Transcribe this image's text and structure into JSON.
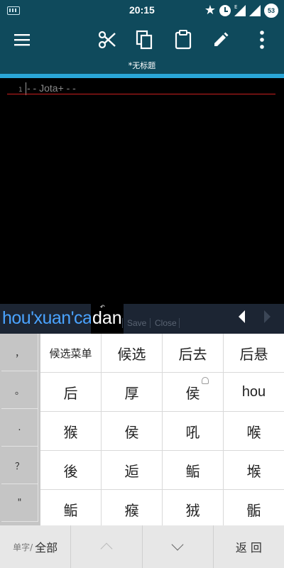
{
  "status_bar": {
    "time": "20:15",
    "network_label": "E",
    "battery": "53",
    "icons": [
      "keyboard-icon",
      "star-icon",
      "alarm-icon",
      "signal-icon",
      "battery-icon"
    ]
  },
  "toolbar": {
    "icons": [
      "menu-icon",
      "cut-icon",
      "copy-icon",
      "paste-icon",
      "edit-icon",
      "more-icon"
    ],
    "doc_title": "*无标题"
  },
  "editor": {
    "line_number": "1",
    "line_text": "- - Jota+ - -"
  },
  "ime": {
    "composing_prefix": "hou'xuan'cai'",
    "composing_active": "dan",
    "save_label": "Save",
    "close_label": "Close",
    "punctuation": [
      "，",
      "。",
      ".",
      "？",
      "\""
    ],
    "candidates": [
      [
        "候选菜单",
        "候选",
        "后去",
        "后悬"
      ],
      [
        "后",
        "厚",
        "侯",
        "hou"
      ],
      [
        "猴",
        "侯",
        "吼",
        "喉"
      ],
      [
        "後",
        "逅",
        "鲘",
        "堠"
      ],
      [
        "鲘",
        "瘊",
        "狨",
        "骺"
      ]
    ],
    "bottom": {
      "mode_small": "单字/",
      "mode_label": "全部",
      "back_label": "返 回"
    }
  },
  "colors": {
    "primary": "#0f4a5c",
    "accent": "#2aa7d8",
    "composing": "#4aa3ff",
    "cursor_line": "#cc1f1f"
  }
}
